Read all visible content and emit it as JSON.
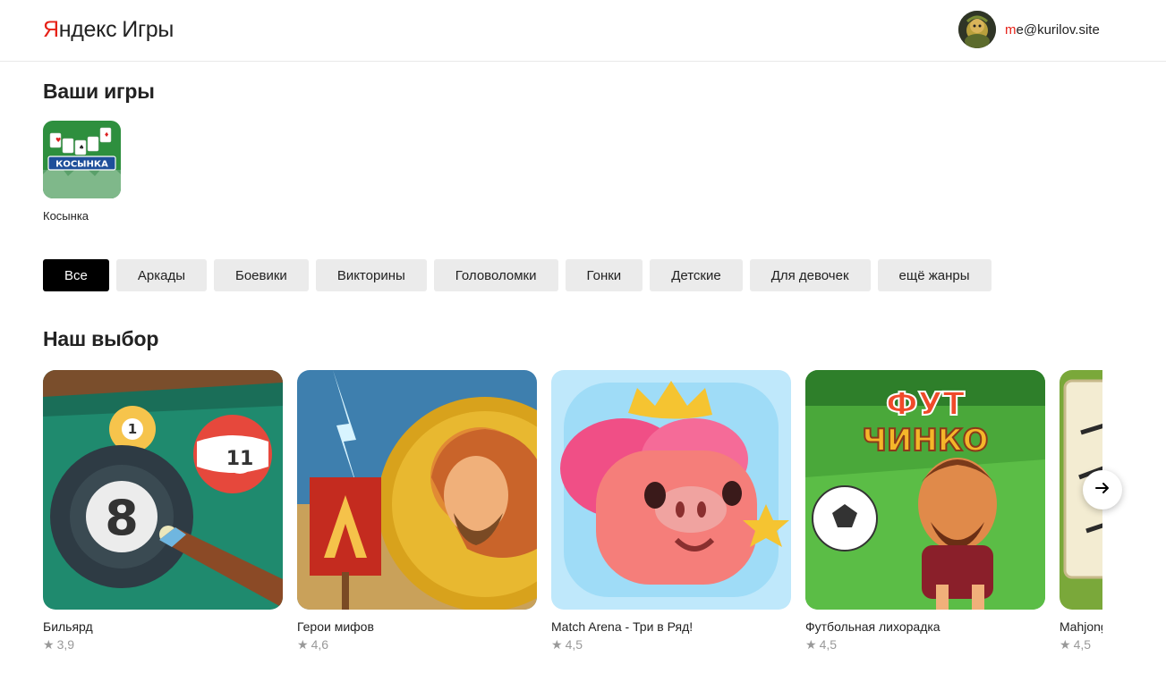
{
  "header": {
    "logo_y": "Я",
    "logo_rest": "ндекс",
    "logo_games": "Игры",
    "user_email_first": "m",
    "user_email_rest": "e@kurilov.site"
  },
  "your_games": {
    "title": "Ваши игры",
    "items": [
      {
        "name": "Косынка",
        "banner": "КОСЫНКА"
      }
    ]
  },
  "genres": {
    "items": [
      {
        "label": "Все",
        "active": true
      },
      {
        "label": "Аркады"
      },
      {
        "label": "Боевики"
      },
      {
        "label": "Викторины"
      },
      {
        "label": "Головоломки"
      },
      {
        "label": "Гонки"
      },
      {
        "label": "Детские"
      },
      {
        "label": "Для девочек"
      },
      {
        "label": "ещё жанры"
      }
    ]
  },
  "our_choice": {
    "title": "Наш выбор",
    "games": [
      {
        "title": "Бильярд",
        "rating": "3,9",
        "ball1": "1",
        "ball2": "11",
        "ball3": "8"
      },
      {
        "title": "Герои мифов",
        "rating": "4,6"
      },
      {
        "title": "Match Arena - Три в Ряд!",
        "rating": "4,5"
      },
      {
        "title": "Футбольная лихорадка",
        "rating": "4,5",
        "logo1": "ФУТ",
        "logo2": "ЧИНКО"
      },
      {
        "title": "Mahjong",
        "rating": "4,5"
      }
    ]
  },
  "icons": {
    "star": "★",
    "next": "arrow-right-icon"
  },
  "colors": {
    "brand_red": "#e62117",
    "chip_active": "#000000",
    "chip_bg": "#ebebeb",
    "rating_gray": "#999999"
  }
}
